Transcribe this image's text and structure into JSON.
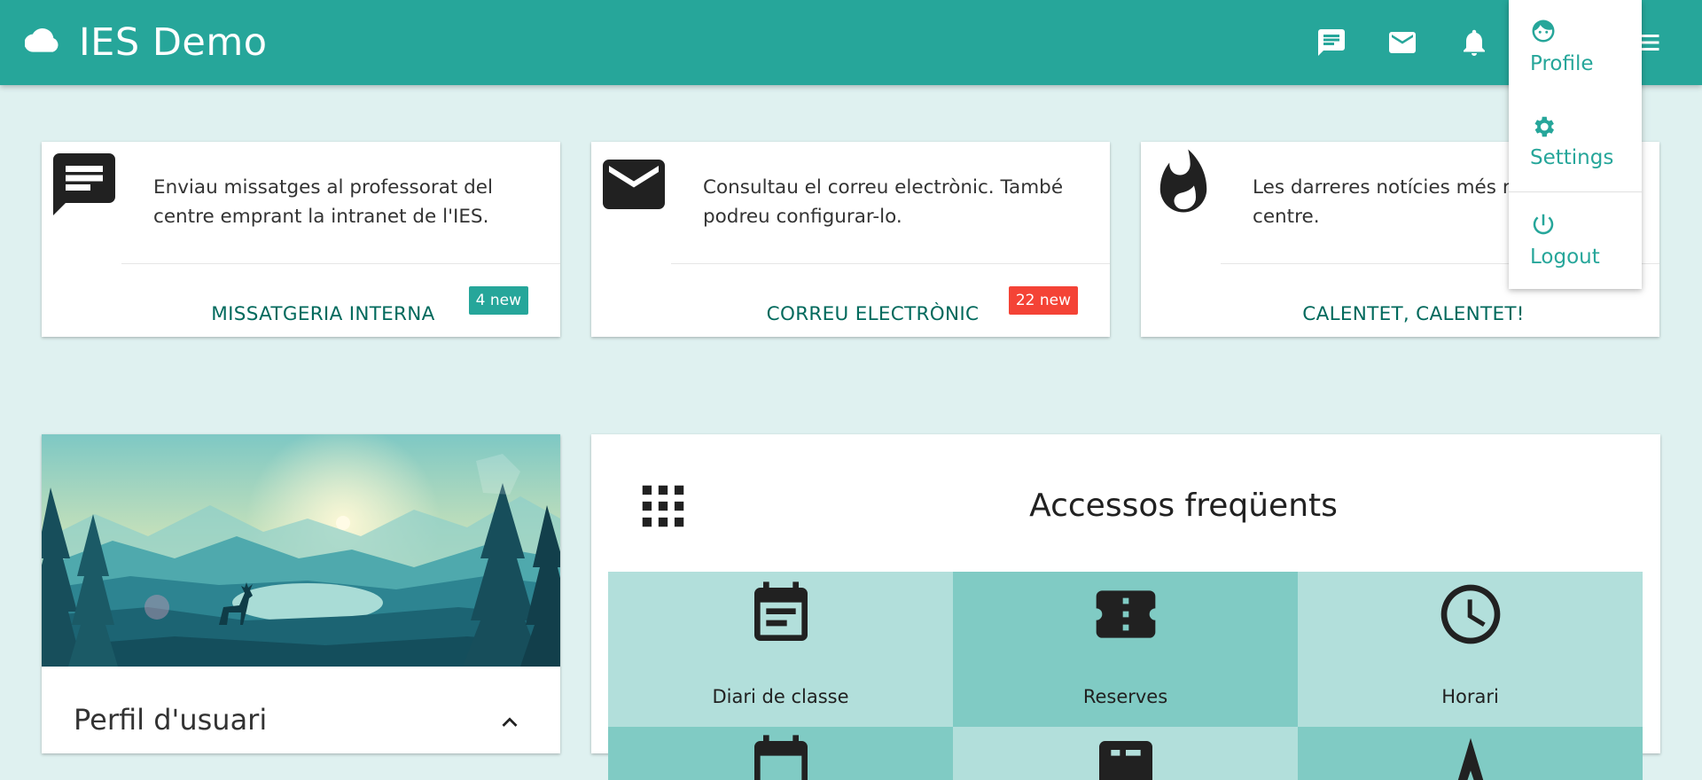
{
  "header": {
    "title": "IES Demo",
    "brand_icon": "cloud-icon",
    "icons": [
      "chat-icon",
      "mail-icon",
      "notifications-icon",
      "menu-icon"
    ]
  },
  "user_menu": {
    "items": [
      {
        "label": "Profile",
        "icon": "face-icon"
      },
      {
        "label": "Settings",
        "icon": "gear-icon"
      },
      {
        "label": "Logout",
        "icon": "power-icon"
      }
    ]
  },
  "cards": [
    {
      "icon": "message-icon",
      "text": "Enviau missatges al professorat del centre emprant la intranet de l'IES.",
      "action": "Missatgeria interna",
      "badge": "4 new",
      "badge_color": "#26a69a"
    },
    {
      "icon": "mail-icon",
      "text": "Consultau el correu electrònic. També podreu configurar-lo.",
      "action": "Correu electrònic",
      "badge": "22 new",
      "badge_color": "#f44336"
    },
    {
      "icon": "whatshot-icon",
      "text": "Les darreres notícies més rellevants del centre.",
      "action": "Calentet, calentet!"
    }
  ],
  "profile": {
    "title": "Perfil d'usuari"
  },
  "access": {
    "title": "Accessos freqüents",
    "tiles": [
      {
        "label": "Diari de classe",
        "icon": "calendar-icon",
        "color": "#b2dfdb"
      },
      {
        "label": "Reserves",
        "icon": "ticket-icon",
        "color": "#80cbc4"
      },
      {
        "label": "Horari",
        "icon": "clock-icon",
        "color": "#b2dfdb"
      }
    ],
    "row2_colors": [
      "#80cbc4",
      "#b2dfdb",
      "#80cbc4"
    ]
  },
  "colors": {
    "primary": "#26a69a",
    "background": "#dff1f0",
    "link": "#00695c"
  }
}
